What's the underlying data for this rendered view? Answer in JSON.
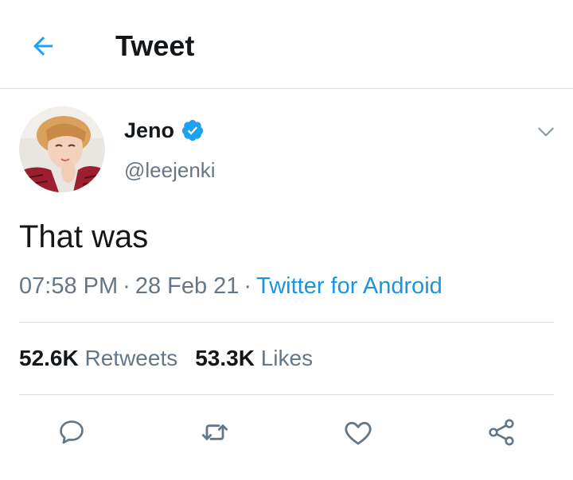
{
  "header": {
    "title": "Tweet",
    "back_icon": "arrow-left-icon",
    "accent": "#1da1f2"
  },
  "tweet": {
    "author": {
      "display_name": "Jeno",
      "handle": "@leejenki",
      "verified": true,
      "verified_color": "#1da1f2"
    },
    "text": "That was",
    "time": "07:58 PM",
    "date": "28 Feb 21",
    "separator": "·",
    "source": "Twitter for Android",
    "source_color": "#1b95e0"
  },
  "stats": {
    "retweets_count": "52.6K",
    "retweets_label": "Retweets",
    "likes_count": "53.3K",
    "likes_label": "Likes"
  },
  "actions": [
    "reply-icon",
    "retweet-icon",
    "like-icon",
    "share-icon"
  ],
  "colors": {
    "text_primary": "#14171a",
    "text_secondary": "#657786",
    "divider": "#d8dee3",
    "icon": "#657786"
  }
}
